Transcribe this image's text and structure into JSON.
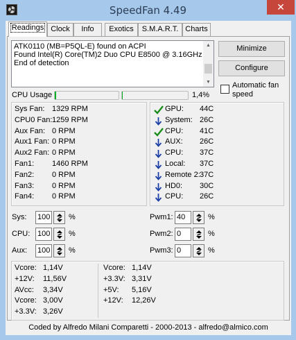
{
  "window": {
    "title": "SpeedFan 4.49",
    "close_glyph": "✕"
  },
  "tabs": [
    {
      "label": "Readings",
      "active": true
    },
    {
      "label": "Clock"
    },
    {
      "label": "Info"
    },
    {
      "label": "Exotics"
    },
    {
      "label": "S.M.A.R.T."
    },
    {
      "label": "Charts"
    }
  ],
  "log": {
    "lines": [
      "ATK0110 (MB=P5QL-E) found on ACPI",
      "Found Intel(R) Core(TM)2 Duo CPU E8500 @ 3.16GHz",
      "End of detection"
    ]
  },
  "buttons": {
    "minimize": "Minimize",
    "configure": "Configure"
  },
  "auto_fan": {
    "label_line1": "Automatic fan",
    "label_line2": "speed",
    "checked": false
  },
  "cpu_usage": {
    "label": "CPU Usage",
    "value_text": "1,4%",
    "core1_fraction": 0.02,
    "core2_fraction": 0.01
  },
  "fans": [
    {
      "name": "Sys Fan:",
      "value": "1329 RPM"
    },
    {
      "name": "CPU0 Fan:",
      "value": "1259 RPM"
    },
    {
      "name": "Aux Fan:",
      "value": "0 RPM"
    },
    {
      "name": "Aux1 Fan:",
      "value": "0 RPM"
    },
    {
      "name": "Aux2 Fan:",
      "value": "0 RPM"
    },
    {
      "name": "Fan1:",
      "value": "1460 RPM"
    },
    {
      "name": "Fan2:",
      "value": "0 RPM"
    },
    {
      "name": "Fan3:",
      "value": "0 RPM"
    },
    {
      "name": "Fan4:",
      "value": "0 RPM"
    }
  ],
  "temps": [
    {
      "name": "GPU:",
      "value": "44C",
      "icon": "check-icon"
    },
    {
      "name": "System:",
      "value": "26C",
      "icon": "down-arrow-icon"
    },
    {
      "name": "CPU:",
      "value": "41C",
      "icon": "check-icon"
    },
    {
      "name": "AUX:",
      "value": "26C",
      "icon": "down-arrow-icon"
    },
    {
      "name": "CPU:",
      "value": "37C",
      "icon": "down-arrow-icon"
    },
    {
      "name": "Local:",
      "value": "37C",
      "icon": "down-arrow-icon"
    },
    {
      "name": "Remote 2:",
      "value": "37C",
      "icon": "down-arrow-icon"
    },
    {
      "name": "HD0:",
      "value": "30C",
      "icon": "down-arrow-icon"
    },
    {
      "name": "CPU:",
      "value": "26C",
      "icon": "down-arrow-icon"
    }
  ],
  "speeds_left": [
    {
      "name": "Sys:",
      "value": "100",
      "unit": "%"
    },
    {
      "name": "CPU:",
      "value": "100",
      "unit": "%"
    },
    {
      "name": "Aux:",
      "value": "100",
      "unit": "%"
    }
  ],
  "speeds_right": [
    {
      "name": "Pwm1:",
      "value": "40",
      "unit": "%"
    },
    {
      "name": "Pwm2:",
      "value": "0",
      "unit": "%"
    },
    {
      "name": "Pwm3:",
      "value": "0",
      "unit": "%"
    }
  ],
  "voltages_left": [
    {
      "name": "Vcore:",
      "value": "1,14V"
    },
    {
      "name": "+12V:",
      "value": "11,56V"
    },
    {
      "name": "AVcc:",
      "value": "3,34V"
    },
    {
      "name": "Vcore:",
      "value": "3,00V"
    },
    {
      "name": "+3.3V:",
      "value": "3,26V"
    }
  ],
  "voltages_right": [
    {
      "name": "Vcore:",
      "value": "1,14V"
    },
    {
      "name": "+3.3V:",
      "value": "3,31V"
    },
    {
      "name": "+5V:",
      "value": "5,16V"
    },
    {
      "name": "+12V:",
      "value": "12,26V"
    }
  ],
  "status": "Coded by Alfredo Milani Comparetti - 2000-2013 - alfredo@almico.com",
  "colors": {
    "frame": "#a6c8ea",
    "title_text": "#2b3d55",
    "close_button": "#c7463c",
    "check_green": "#1a8c1a",
    "arrow_blue": "#1c3fa8",
    "progress_green": "#06b025"
  }
}
